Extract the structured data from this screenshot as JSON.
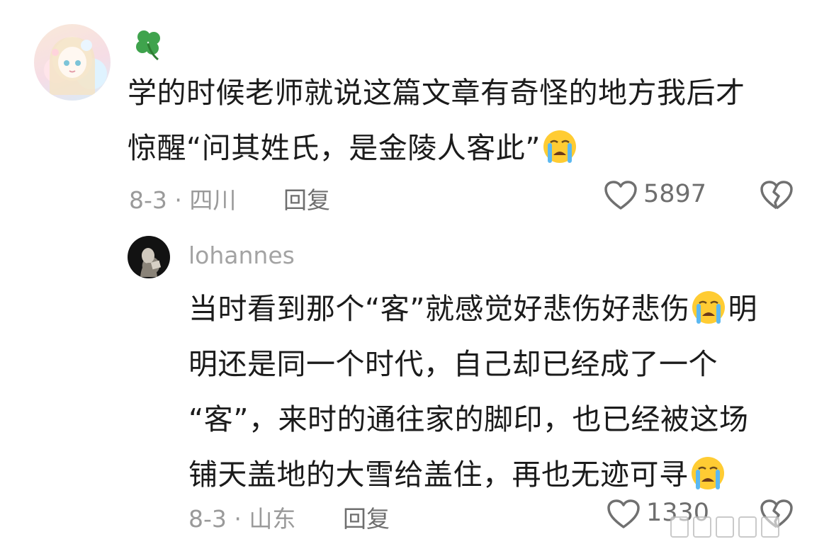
{
  "comment1": {
    "avatar_icon": "anime-girl-avatar",
    "username_icon": "four-leaf-clover-emoji",
    "text_line1": "学的时候老师就说这篇文章有奇怪的地方我后才",
    "text_line2": "惊醒“问其姓氏，是金陵人客此”",
    "emoji": "loudly-crying-face",
    "date_location": "8-3 · 四川",
    "reply_label": "回复",
    "like_count": "5897"
  },
  "comment2": {
    "avatar_icon": "dark-photo-avatar",
    "username": "lohannes",
    "line1": "当时看到那个“客”就感觉好悲伤好悲伤",
    "line1_tail": "明",
    "line2": "明还是同一个时代，自己却已经成了一个",
    "line3": "“客”，来时的通往家的脚印，也已经被这场",
    "line4": "铺天盖地的大雪给盖住，再也无迹可寻",
    "date_location": "8-3 · 山东",
    "reply_label": "回复",
    "like_count": "1330"
  },
  "colors": {
    "text": "#1b1b1b",
    "meta": "#9a9a9a",
    "icon": "#707070",
    "background": "#ffffff"
  }
}
